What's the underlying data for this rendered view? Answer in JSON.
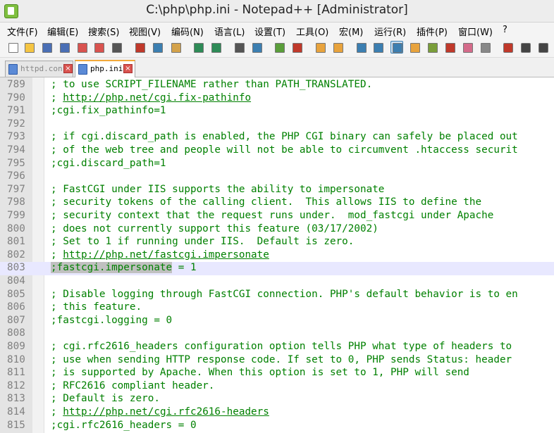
{
  "window": {
    "title": "C:\\php\\php.ini - Notepad++ [Administrator]"
  },
  "menu": [
    "文件(F)",
    "编辑(E)",
    "搜索(S)",
    "视图(V)",
    "编码(N)",
    "语言(L)",
    "设置(T)",
    "工具(O)",
    "宏(M)",
    "运行(R)",
    "插件(P)",
    "窗口(W)",
    "?"
  ],
  "toolbar_icons": [
    "new-file-icon",
    "open-file-icon",
    "save-icon",
    "save-all-icon",
    "close-icon",
    "close-all-icon",
    "print-icon",
    "cut-icon",
    "copy-icon",
    "paste-icon",
    "undo-icon",
    "redo-icon",
    "find-icon",
    "replace-icon",
    "zoom-in-icon",
    "zoom-out-icon",
    "sync-vertical-icon",
    "sync-horizontal-icon",
    "word-wrap-icon",
    "show-all-chars-icon",
    "indent-guide-icon",
    "doc-map-icon",
    "function-list-icon",
    "folder-workspace-icon",
    "clipboard-history-icon",
    "monitor-icon",
    "record-macro-icon",
    "stop-macro-icon",
    "play-macro-icon"
  ],
  "tabs": [
    {
      "label": "httpd.conf",
      "active": false
    },
    {
      "label": "php.ini",
      "active": true
    }
  ],
  "lines": [
    {
      "num": "789",
      "text": "; to use SCRIPT_FILENAME rather than PATH_TRANSLATED."
    },
    {
      "num": "790",
      "pre": "; ",
      "link": "http://php.net/cgi.fix-pathinfo"
    },
    {
      "num": "791",
      "text": ";cgi.fix_pathinfo=1"
    },
    {
      "num": "792",
      "text": ""
    },
    {
      "num": "793",
      "text": "; if cgi.discard_path is enabled, the PHP CGI binary can safely be placed out"
    },
    {
      "num": "794",
      "text": "; of the web tree and people will not be able to circumvent .htaccess securit"
    },
    {
      "num": "795",
      "text": ";cgi.discard_path=1"
    },
    {
      "num": "796",
      "text": ""
    },
    {
      "num": "797",
      "text": "; FastCGI under IIS supports the ability to impersonate"
    },
    {
      "num": "798",
      "text": "; security tokens of the calling client.  This allows IIS to define the"
    },
    {
      "num": "799",
      "text": "; security context that the request runs under.  mod_fastcgi under Apache"
    },
    {
      "num": "800",
      "text": "; does not currently support this feature (03/17/2002)"
    },
    {
      "num": "801",
      "text": "; Set to 1 if running under IIS.  Default is zero."
    },
    {
      "num": "802",
      "pre": "; ",
      "link": "http://php.net/fastcgi.impersonate"
    },
    {
      "num": "803",
      "pre": ";",
      "hl": "fastcgi.impersonate",
      "post": " = 1",
      "current": true
    },
    {
      "num": "804",
      "text": ""
    },
    {
      "num": "805",
      "text": "; Disable logging through FastCGI connection. PHP's default behavior is to en"
    },
    {
      "num": "806",
      "text": "; this feature."
    },
    {
      "num": "807",
      "text": ";fastcgi.logging = 0"
    },
    {
      "num": "808",
      "text": ""
    },
    {
      "num": "809",
      "text": "; cgi.rfc2616_headers configuration option tells PHP what type of headers to"
    },
    {
      "num": "810",
      "text": "; use when sending HTTP response code. If set to 0, PHP sends Status: header"
    },
    {
      "num": "811",
      "text": "; is supported by Apache. When this option is set to 1, PHP will send"
    },
    {
      "num": "812",
      "text": "; RFC2616 compliant header."
    },
    {
      "num": "813",
      "text": "; Default is zero."
    },
    {
      "num": "814",
      "pre": "; ",
      "link": "http://php.net/cgi.rfc2616-headers"
    },
    {
      "num": "815",
      "text": ";cgi.rfc2616_headers = 0"
    }
  ]
}
